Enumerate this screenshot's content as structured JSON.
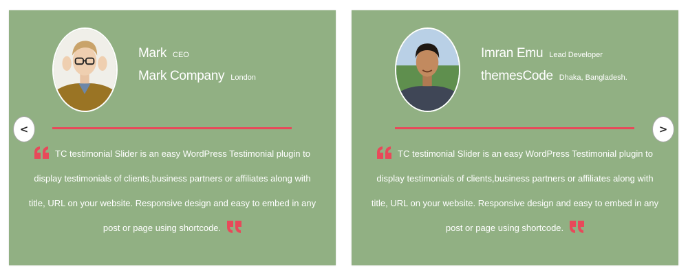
{
  "slider": {
    "prev_label": "<",
    "next_label": ">",
    "slides": [
      {
        "name": "Mark",
        "role": "CEO",
        "company": "Mark Company",
        "location": "London",
        "text": "TC testimonial Slider is an easy WordPress Testimonial plugin to display testimonials of clients,business partners or affiliates along with title, URL on your website. Responsive design and easy to embed in any post or page using shortcode."
      },
      {
        "name": "Imran Emu",
        "role": "Lead Developer",
        "company": "themesCode",
        "location": "Dhaka, Bangladesh.",
        "text": "TC testimonial Slider is an easy WordPress Testimonial plugin to display testimonials of clients,business partners or affiliates along with title, URL on your website. Responsive design and easy to embed in any post or page using shortcode."
      }
    ]
  },
  "colors": {
    "card_background": "#91b083",
    "accent": "#e8495a",
    "text": "#ffffff"
  },
  "icons": {
    "open_quote": "quote-open-icon",
    "close_quote": "quote-close-icon",
    "prev": "chevron-left-icon",
    "next": "chevron-right-icon"
  }
}
